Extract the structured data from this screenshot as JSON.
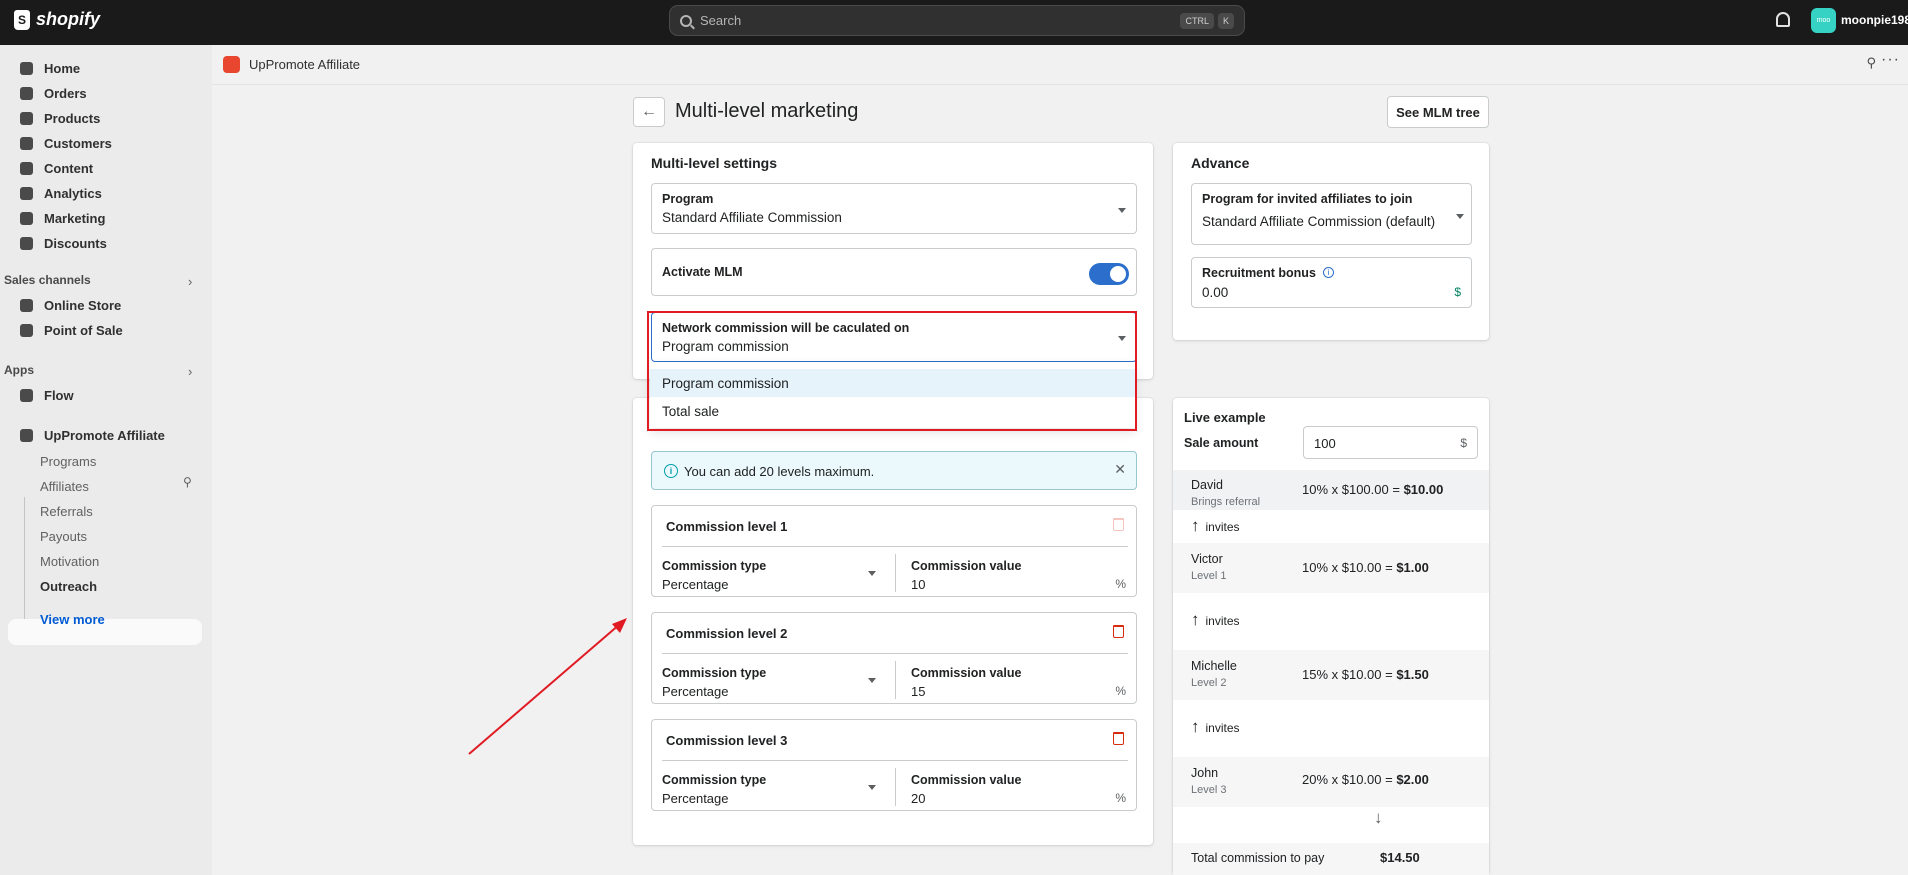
{
  "topbar": {
    "brand": "shopify",
    "search_placeholder": "Search",
    "shortcut_keys": [
      "CTRL",
      "K"
    ],
    "avatar_initials": "moo",
    "username": "moonpie198"
  },
  "sidebar": {
    "main_items": [
      {
        "label": "Home",
        "icon": "home-icon"
      },
      {
        "label": "Orders",
        "icon": "inbox-icon"
      },
      {
        "label": "Products",
        "icon": "tag-icon"
      },
      {
        "label": "Customers",
        "icon": "person-icon"
      },
      {
        "label": "Content",
        "icon": "image-icon"
      },
      {
        "label": "Analytics",
        "icon": "bar-chart-icon"
      },
      {
        "label": "Marketing",
        "icon": "target-icon"
      },
      {
        "label": "Discounts",
        "icon": "discount-icon"
      }
    ],
    "sales_channels_label": "Sales channels",
    "sales_channels": [
      {
        "label": "Online Store",
        "icon": "store-icon"
      },
      {
        "label": "Point of Sale",
        "icon": "pos-icon"
      }
    ],
    "apps_label": "Apps",
    "apps": [
      {
        "label": "Flow",
        "icon": "flow-icon"
      },
      {
        "label": "UpPromote Affiliate",
        "icon": "app-icon"
      }
    ],
    "app_sub_items": [
      "Programs",
      "Affiliates",
      "Referrals",
      "Payouts",
      "Motivation",
      "Outreach"
    ],
    "active_sub_item": "Outreach",
    "view_more": "View more"
  },
  "appbar": {
    "title": "UpPromote Affiliate"
  },
  "page": {
    "title": "Multi-level marketing",
    "see_tree_button": "See MLM tree"
  },
  "settings": {
    "title": "Multi-level settings",
    "program_label": "Program",
    "program_value": "Standard Affiliate Commission",
    "activate_label": "Activate MLM",
    "activate_on": true,
    "network_label": "Network commission will be caculated on",
    "network_value": "Program commission",
    "network_options": [
      "Program commission",
      "Total sale"
    ],
    "banner_text": "You can add 20 levels maximum.",
    "levels": [
      {
        "title": "Commission level 1",
        "type_label": "Commission type",
        "type_value": "Percentage",
        "value_label": "Commission value",
        "value": "10",
        "unit": "%"
      },
      {
        "title": "Commission level 2",
        "type_label": "Commission type",
        "type_value": "Percentage",
        "value_label": "Commission value",
        "value": "15",
        "unit": "%"
      },
      {
        "title": "Commission level 3",
        "type_label": "Commission type",
        "type_value": "Percentage",
        "value_label": "Commission value",
        "value": "20",
        "unit": "%"
      }
    ]
  },
  "advance": {
    "title": "Advance",
    "join_label": "Program for invited affiliates to join",
    "join_value": "Standard Affiliate Commission (default)",
    "bonus_label": "Recruitment bonus",
    "bonus_value": "0.00",
    "bonus_unit": "$"
  },
  "live": {
    "title": "Live example",
    "sale_label": "Sale amount",
    "sale_value": "100",
    "sale_unit": "$",
    "rows": [
      {
        "name": "David",
        "sub": "Brings referral",
        "calc": "10% x $100.00 = ",
        "result": "$10.00"
      },
      {
        "name": "Victor",
        "sub": "Level 1",
        "calc": "10% x $10.00 = ",
        "result": "$1.00"
      },
      {
        "name": "Michelle",
        "sub": "Level 2",
        "calc": "15% x $10.00 = ",
        "result": "$1.50"
      },
      {
        "name": "John",
        "sub": "Level 3",
        "calc": "20% x $10.00 = ",
        "result": "$2.00"
      }
    ],
    "invites_label": "invites",
    "total_label": "Total commission to pay",
    "total_value": "$14.50"
  },
  "colors": {
    "accent": "#2c6ecb",
    "highlight": "#e01b24",
    "danger": "#d72c0d"
  }
}
